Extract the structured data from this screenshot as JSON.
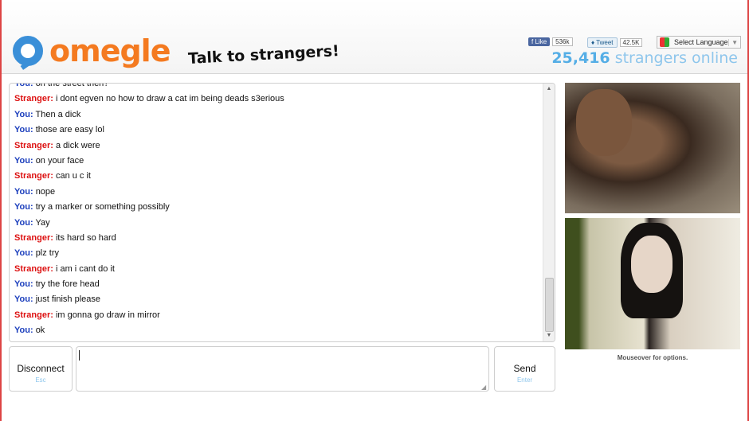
{
  "brand": {
    "name": "omegle",
    "tagline": "Talk to strangers!"
  },
  "social": {
    "like_label": "Like",
    "like_count": "536k",
    "tweet_label": "Tweet",
    "tweet_count": "42.5K",
    "language_label": "Select Language"
  },
  "online": {
    "count": "25,416",
    "label": "strangers online"
  },
  "chat": {
    "messages": [
      {
        "who": "You:",
        "text": "on the street then?"
      },
      {
        "who": "Stranger:",
        "text": "i dont egven no how to draw a cat im being deads s3erious"
      },
      {
        "who": "You:",
        "text": "Then a dick"
      },
      {
        "who": "You:",
        "text": "those are easy lol"
      },
      {
        "who": "Stranger:",
        "text": "a dick were"
      },
      {
        "who": "You:",
        "text": "on your face"
      },
      {
        "who": "Stranger:",
        "text": "can u c it"
      },
      {
        "who": "You:",
        "text": "nope"
      },
      {
        "who": "You:",
        "text": "try a marker or something possibly"
      },
      {
        "who": "You:",
        "text": "Yay"
      },
      {
        "who": "Stranger:",
        "text": "its hard so hard"
      },
      {
        "who": "You:",
        "text": "plz try"
      },
      {
        "who": "Stranger:",
        "text": "i am i cant do it"
      },
      {
        "who": "You:",
        "text": "try the fore head"
      },
      {
        "who": "You:",
        "text": "just finish please"
      },
      {
        "who": "Stranger:",
        "text": "im gonna go draw in mirror"
      },
      {
        "who": "You:",
        "text": "ok"
      }
    ]
  },
  "controls": {
    "disconnect_label": "Disconnect",
    "disconnect_hint": "Esc",
    "send_label": "Send",
    "send_hint": "Enter",
    "message_value": ""
  },
  "video": {
    "options_hint": "Mouseover for options."
  },
  "colors": {
    "you": "#1c3fbd",
    "stranger": "#dd1111",
    "logo_orange": "#f47a20",
    "logo_blue": "#3a8fd8",
    "online_blue": "#55aee6"
  }
}
